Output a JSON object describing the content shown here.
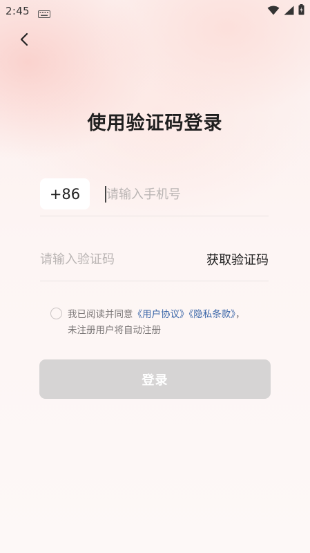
{
  "status_bar": {
    "time": "2:45",
    "icons": [
      "keyboard-icon",
      "wifi-icon",
      "signal-icon",
      "battery-icon"
    ]
  },
  "nav": {
    "back_icon": "chevron-left-icon"
  },
  "page": {
    "title": "使用验证码登录"
  },
  "phone": {
    "country_code": "+86",
    "placeholder": "请输入手机号",
    "value": ""
  },
  "code": {
    "placeholder": "请输入验证码",
    "value": "",
    "get_code_label": "获取验证码"
  },
  "agreement": {
    "checked": false,
    "prefix": "我已阅读并同意",
    "user_agreement": "《用户协议》",
    "privacy_policy": "《隐私条款》",
    "comma": "，",
    "note": "未注册用户将自动注册"
  },
  "login_button": {
    "label": "登录"
  },
  "colors": {
    "link": "#3a66a8",
    "button_disabled": "#d6d4d4",
    "background": "#fdf6f5"
  }
}
